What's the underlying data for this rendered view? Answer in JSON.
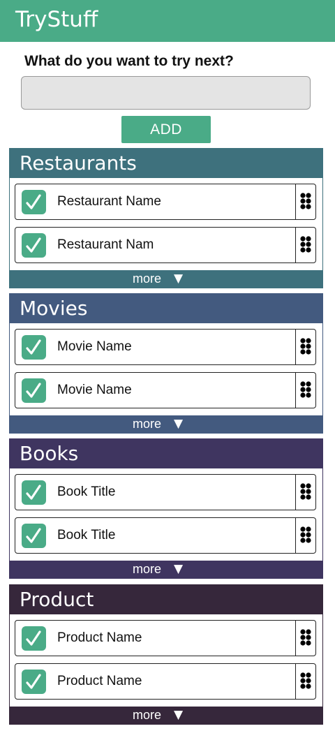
{
  "app": {
    "title": "TryStuff",
    "accent": "#4aab87"
  },
  "form": {
    "prompt": "What do you want to try next?",
    "input_value": "",
    "input_placeholder": "",
    "add_label": "ADD"
  },
  "sections": [
    {
      "title": "Restaurants",
      "color": "#3e717d",
      "items": [
        {
          "label": "Restaurant Name",
          "checked": true
        },
        {
          "label": "Restaurant Nam",
          "checked": true
        }
      ],
      "more_label": "more",
      "more_icon": "▼"
    },
    {
      "title": "Movies",
      "color": "#435a7f",
      "items": [
        {
          "label": "Movie Name",
          "checked": true
        },
        {
          "label": "Movie Name",
          "checked": true
        }
      ],
      "more_label": "more",
      "more_icon": "▼"
    },
    {
      "title": "Books",
      "color": "#3f3560",
      "items": [
        {
          "label": "Book Title",
          "checked": true
        },
        {
          "label": "Book Title",
          "checked": true
        }
      ],
      "more_label": "more",
      "more_icon": "▼"
    },
    {
      "title": "Product",
      "color": "#36273b",
      "items": [
        {
          "label": "Product Name",
          "checked": true
        },
        {
          "label": "Product Name",
          "checked": true
        }
      ],
      "more_label": "more",
      "more_icon": "▼"
    }
  ],
  "icons": {
    "check": "checkmark-icon",
    "drag": "drag-handle-icon",
    "more": "caret-down-icon"
  }
}
